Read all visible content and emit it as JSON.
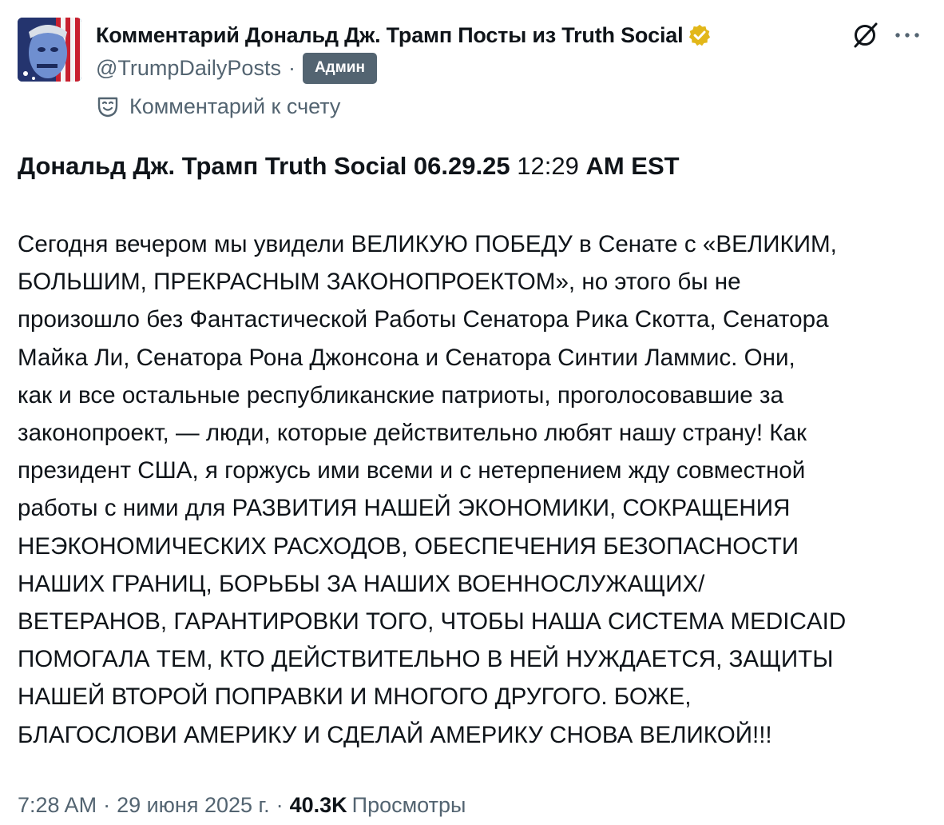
{
  "header": {
    "display_name": "Комментарий Дональд Дж. Трамп Посты из Truth Social",
    "handle": "@TrumpDailyPosts",
    "separator": "·",
    "badge": "Админ",
    "verified_badge_color": "#e2b719",
    "badge_bg_color": "#536471"
  },
  "community_note": {
    "label": "Комментарий к счету",
    "icon": "theater-mask-icon"
  },
  "post": {
    "title_bold": "Дональд Дж. Трамп Truth Social 06.29.25",
    "title_time": "12:29",
    "title_suffix": "AM EST",
    "body_lines": [
      "Сегодня вечером мы увидели ВЕЛИКУЮ ПОБЕДУ в Сенате с «ВЕЛИКИМ,",
      "БОЛЬШИМ, ПРЕКРАСНЫМ ЗАКОНОПРОЕКТОМ», но этого бы не",
      "произошло без Фантастической Работы Сенатора Рика Скотта, Сенатора",
      "Майка Ли, Сенатора Рона Джонсона и Сенатора Синтии Ламмис. Они,",
      "как и все остальные республиканские патриоты, проголосовавшие за",
      "законопроект, — люди, которые действительно любят нашу страну! Как",
      "президент США, я горжусь ими всеми и с нетерпением жду совместной",
      "работы с ними для РАЗВИТИЯ НАШЕЙ ЭКОНОМИКИ, СОКРАЩЕНИЯ",
      "НЕЭКОНОМИЧЕСКИХ РАСХОДОВ, ОБЕСПЕЧЕНИЯ БЕЗОПАСНОСТИ",
      "НАШИХ ГРАНИЦ, БОРЬБЫ ЗА НАШИХ ВОЕННОСЛУЖАЩИХ/",
      "ВЕТЕРАНОВ, ГАРАНТИРОВКИ ТОГО, ЧТОБЫ НАША СИСТЕМА MEDICAID",
      "ПОМОГАЛА ТЕМ, КТО ДЕЙСТВИТЕЛЬНО В НЕЙ НУЖДАЕТСЯ, ЗАЩИТЫ",
      "НАШЕЙ ВТОРОЙ ПОПРАВКИ И МНОГОГО ДРУГОГО. БОЖЕ,",
      "БЛАГОСЛОВИ АМЕРИКУ И СДЕЛАЙ АМЕРИКУ СНОВА ВЕЛИКОЙ!!!"
    ]
  },
  "meta": {
    "time": "7:28 AM",
    "separator": "·",
    "date": "29 июня 2025 г.",
    "views_count": "40.3K",
    "views_label": "Просмотры"
  },
  "icons": {
    "avatar": "avatar",
    "verified": "verified-badge-icon",
    "grok": "grok-icon",
    "more": "more-options-icon"
  }
}
